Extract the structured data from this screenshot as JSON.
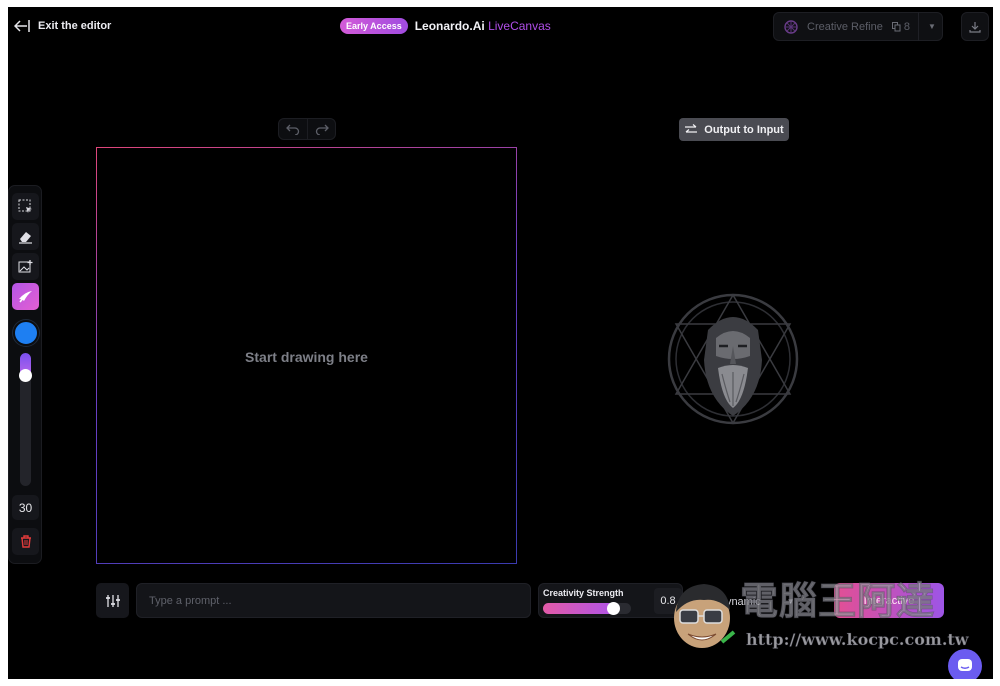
{
  "header": {
    "exit_label": "Exit the editor",
    "badge": "Early Access",
    "brand_name": "Leonardo.Ai",
    "brand_product": "LiveCanvas",
    "refine_label": "Creative Refine",
    "refine_count": "8"
  },
  "toolbar": {
    "tools": [
      {
        "name": "select-tool",
        "icon": "selection-icon"
      },
      {
        "name": "eraser-tool",
        "icon": "eraser-icon"
      },
      {
        "name": "image-upload-tool",
        "icon": "image-plus-icon"
      },
      {
        "name": "brush-tool",
        "icon": "brush-icon",
        "active": true
      }
    ],
    "brush_color": "#1e7ff2",
    "brush_size_level": 0.15,
    "brush_size": "30"
  },
  "canvas": {
    "hint": "Start drawing here"
  },
  "output": {
    "button_label": "Output to Input"
  },
  "prompt": {
    "placeholder": "Type a prompt ..."
  },
  "creativity": {
    "label": "Creativity Strength",
    "value": "0.8",
    "level": 0.8
  },
  "style": {
    "label": "Dynamic"
  },
  "mode": {
    "label": "Interactive"
  },
  "watermark": {
    "title": "電腦王阿達",
    "url": "http://www.kocpc.com.tw"
  },
  "colors": {
    "accent": "#b04ee8",
    "background": "#000000",
    "brush": "#1e7ff2",
    "danger": "#e23b3b"
  }
}
